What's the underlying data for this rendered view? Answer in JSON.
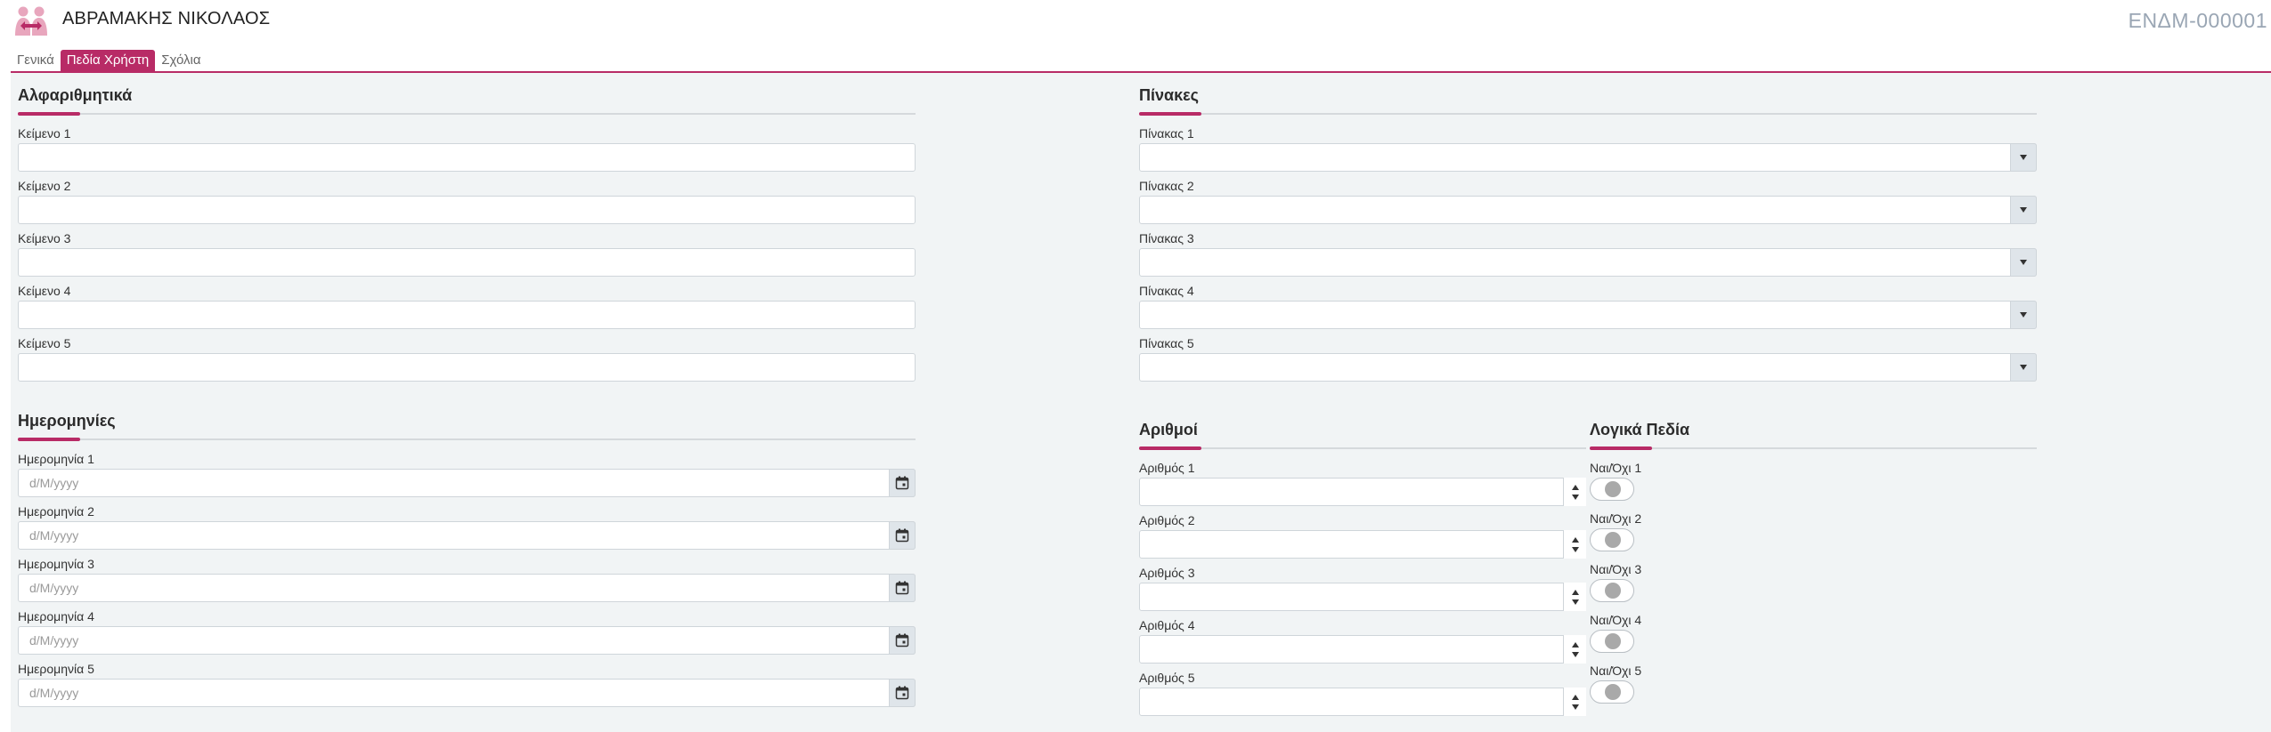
{
  "header": {
    "title": "ΑΒΡΑΜΑΚΗΣ ΝΙΚΟΛΑΟΣ",
    "code": "ΕΝΔΜ-000001",
    "accent_color": "#b82b66"
  },
  "tabs": [
    {
      "label": "Γενικά",
      "active": false
    },
    {
      "label": "Πεδία Χρήστη",
      "active": true
    },
    {
      "label": "Σχόλια",
      "active": false
    }
  ],
  "alphanumeric": {
    "title": "Αλφαριθμητικά",
    "fields": [
      {
        "label": "Κείμενο 1",
        "value": ""
      },
      {
        "label": "Κείμενο 2",
        "value": ""
      },
      {
        "label": "Κείμενο 3",
        "value": ""
      },
      {
        "label": "Κείμενο 4",
        "value": ""
      },
      {
        "label": "Κείμενο 5",
        "value": ""
      }
    ]
  },
  "dates": {
    "title": "Ημερομηνίες",
    "fields": [
      {
        "label": "Ημερομηνία 1",
        "placeholder": "d/M/yyyy"
      },
      {
        "label": "Ημερομηνία 2",
        "placeholder": "d/M/yyyy"
      },
      {
        "label": "Ημερομηνία 3",
        "placeholder": "d/M/yyyy"
      },
      {
        "label": "Ημερομηνία 4",
        "placeholder": "d/M/yyyy"
      },
      {
        "label": "Ημερομηνία 5",
        "placeholder": "d/M/yyyy"
      }
    ]
  },
  "tables": {
    "title": "Πίνακες",
    "fields": [
      {
        "label": "Πίνακας 1",
        "value": ""
      },
      {
        "label": "Πίνακας 2",
        "value": ""
      },
      {
        "label": "Πίνακας 3",
        "value": ""
      },
      {
        "label": "Πίνακας 4",
        "value": ""
      },
      {
        "label": "Πίνακας 5",
        "value": ""
      }
    ]
  },
  "numbers": {
    "title": "Αριθμοί",
    "fields": [
      {
        "label": "Αριθμός 1",
        "value": ""
      },
      {
        "label": "Αριθμός 2",
        "value": ""
      },
      {
        "label": "Αριθμός 3",
        "value": ""
      },
      {
        "label": "Αριθμός 4",
        "value": ""
      },
      {
        "label": "Αριθμός 5",
        "value": ""
      }
    ]
  },
  "booleans": {
    "title": "Λογικά Πεδία",
    "fields": [
      {
        "label": "Ναι/Όχι 1",
        "checked": false
      },
      {
        "label": "Ναι/Όχι 2",
        "checked": false
      },
      {
        "label": "Ναι/Όχι 3",
        "checked": false
      },
      {
        "label": "Ναι/Όχι 4",
        "checked": false
      },
      {
        "label": "Ναι/Όχι 5",
        "checked": false
      }
    ]
  }
}
